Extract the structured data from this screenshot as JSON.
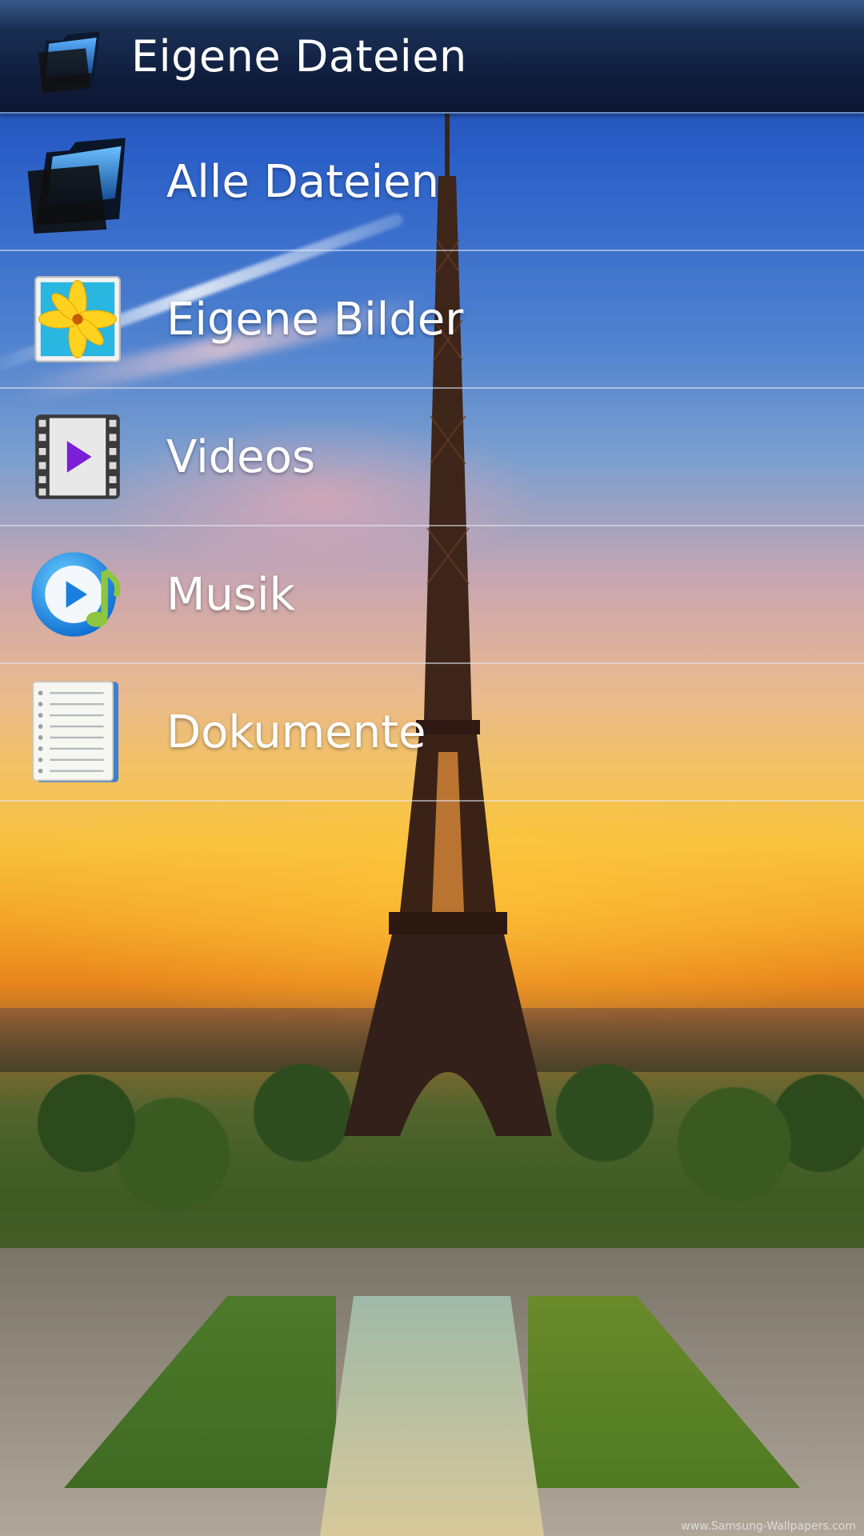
{
  "action_bar": {
    "title": "Eigene Dateien",
    "icon": "folder-icon"
  },
  "list": {
    "items": [
      {
        "label": "Alle Dateien",
        "icon": "folder-icon"
      },
      {
        "label": "Eigene Bilder",
        "icon": "image-icon"
      },
      {
        "label": "Videos",
        "icon": "video-icon"
      },
      {
        "label": "Musik",
        "icon": "music-icon"
      },
      {
        "label": "Dokumente",
        "icon": "document-icon"
      }
    ]
  },
  "wallpaper": {
    "watermark": "www.Samsung-Wallpapers.com"
  },
  "colors": {
    "action_bar": "#0f1d3c",
    "divider": "#e6ebf5",
    "label": "#ffffff"
  }
}
